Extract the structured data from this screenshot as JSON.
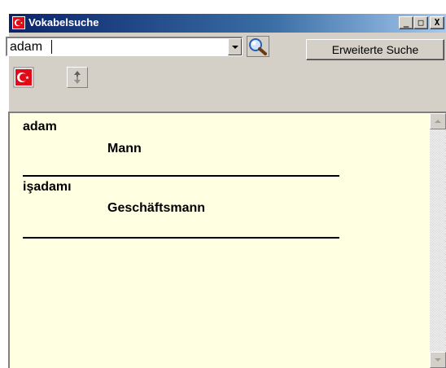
{
  "window": {
    "title": "Vokabelsuche",
    "minimize_label": "_",
    "maximize_label": "□",
    "close_label": "X"
  },
  "toolbar": {
    "search_value": "adam",
    "extended_search_label": "Erweiterte Suche"
  },
  "icons": {
    "app": "turkish-flag-icon",
    "search": "magnifier-icon",
    "language_toggle": "turkish-flag-icon",
    "swap": "swap-direction-icon"
  },
  "results": [
    {
      "word": "adam",
      "translation": "Mann"
    },
    {
      "word": "işadamı",
      "translation": "Geschäftsmann"
    }
  ],
  "colors": {
    "titlebar_start": "#0a246a",
    "titlebar_end": "#a6caf0",
    "flag_red": "#e30a17",
    "results_background": "#ffffe1",
    "window_face": "#d4d0c8"
  }
}
